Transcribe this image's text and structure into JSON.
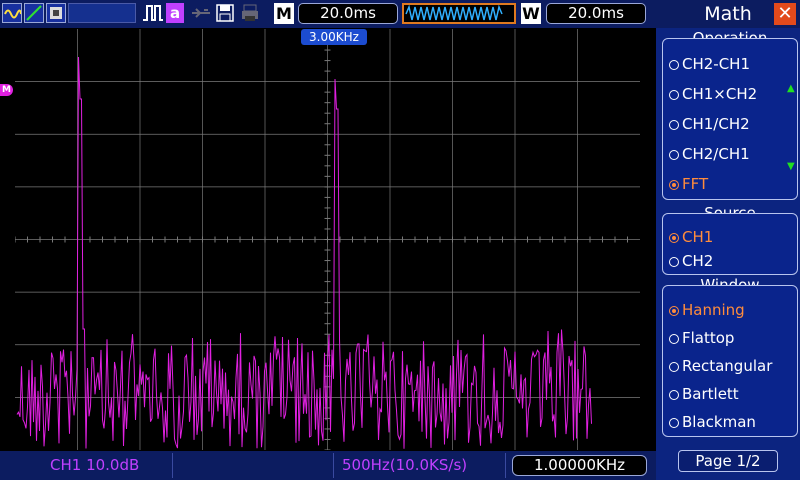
{
  "toolbar": {
    "main_timebase_letter": "M",
    "main_timebase": "20.0ms",
    "window_letter": "W",
    "window_timebase": "20.0ms",
    "acquire_label": "a"
  },
  "screen": {
    "cursor_marker": "3.00KHz",
    "math_marker": "M",
    "colors": {
      "trace": "#e020e0",
      "grid": "#7a7a7a",
      "background": "#000000"
    }
  },
  "bottom": {
    "channel_scale": "CH1 10.0dB",
    "fft_rate": "500Hz(10.0KS/s)",
    "frequency": "1.00000KHz"
  },
  "menu": {
    "title": "Math",
    "close_icon": "close-icon",
    "operation": {
      "title": "Operation",
      "options": [
        "CH2-CH1",
        "CH1×CH2",
        "CH1/CH2",
        "CH2/CH1",
        "FFT"
      ],
      "selected": 4
    },
    "source": {
      "title": "Source",
      "options": [
        "CH1",
        "CH2"
      ],
      "selected": 0
    },
    "window": {
      "title": "Window",
      "options": [
        "Hanning",
        "Flattop",
        "Rectangular",
        "Bartlett",
        "Blackman"
      ],
      "selected": 0
    },
    "page": "Page 1/2"
  }
}
